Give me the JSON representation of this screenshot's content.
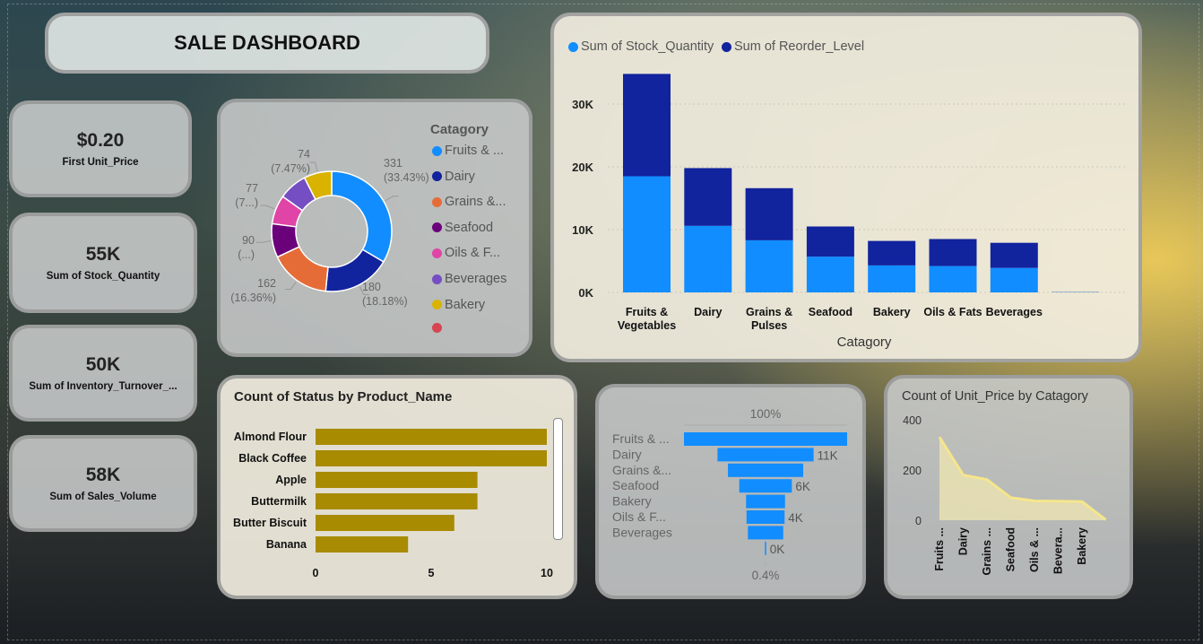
{
  "header": {
    "title": "SALE DASHBOARD"
  },
  "kpis": [
    {
      "value": "$0.20",
      "label": "First Unit_Price"
    },
    {
      "value": "55K",
      "label": "Sum of Stock_Quantity"
    },
    {
      "value": "50K",
      "label": "Sum of Inventory_Turnover_..."
    },
    {
      "value": "58K",
      "label": "Sum of Sales_Volume"
    }
  ],
  "colors": {
    "stock": "#118DFF",
    "reorder": "#12239E",
    "hbar": "#A88B00",
    "funnel": "#118DFF",
    "area_line": "#F5E68C",
    "area_fill": "#F3E9B0"
  },
  "chart_data": [
    {
      "id": "donut",
      "type": "pie",
      "legend_title": "Catagory",
      "legend": [
        "Fruits & ...",
        "Dairy",
        "Grains &...",
        "Seafood",
        "Oils & F...",
        "Beverages",
        "Bakery",
        ""
      ],
      "slices": [
        {
          "value": 331,
          "label": "331",
          "pct": "(33.43%)",
          "color": "#118DFF"
        },
        {
          "value": 180,
          "label": "180",
          "pct": "(18.18%)",
          "color": "#12239E"
        },
        {
          "value": 162,
          "label": "162",
          "pct": "(16.36%)",
          "color": "#E66C37"
        },
        {
          "value": 90,
          "label": "90",
          "pct": "(...)",
          "color": "#6B007B"
        },
        {
          "value": 77,
          "label": "77",
          "pct": "(7...)",
          "color": "#E044A7"
        },
        {
          "value": 76,
          "label": "",
          "pct": "",
          "color": "#744EC2"
        },
        {
          "value": 74,
          "label": "74",
          "pct": "(7.47%)",
          "color": "#D9B300"
        }
      ],
      "legend_colors": [
        "#118DFF",
        "#12239E",
        "#E66C37",
        "#6B007B",
        "#E044A7",
        "#744EC2",
        "#D9B300",
        "#D64550"
      ]
    },
    {
      "id": "stacked",
      "type": "bar",
      "legend": [
        "Sum of Stock_Quantity",
        "Sum of Reorder_Level"
      ],
      "categories": [
        "Fruits & Vegetables",
        "Dairy",
        "Grains & Pulses",
        "Seafood",
        "Bakery",
        "Oils & Fats",
        "Beverages",
        ""
      ],
      "category_lines": [
        [
          "Fruits &",
          "Vegetables"
        ],
        [
          "Dairy"
        ],
        [
          "Grains &",
          "Pulses"
        ],
        [
          "Seafood"
        ],
        [
          "Bakery"
        ],
        [
          "Oils & Fats"
        ],
        [
          "Beverages"
        ],
        [
          ""
        ]
      ],
      "series": [
        {
          "name": "Sum of Stock_Quantity",
          "values": [
            18500,
            10600,
            8300,
            5700,
            4300,
            4200,
            3900,
            80
          ]
        },
        {
          "name": "Sum of Reorder_Level",
          "values": [
            16300,
            9200,
            8300,
            4800,
            3900,
            4300,
            4000,
            40
          ]
        }
      ],
      "xlabel": "Catagory",
      "yticks": [
        "0K",
        "10K",
        "20K",
        "30K"
      ],
      "ylim": [
        0,
        36000
      ]
    },
    {
      "id": "hbar",
      "type": "bar",
      "orientation": "horizontal",
      "title": "Count of Status by Product_Name",
      "categories": [
        "Almond Flour",
        "Black Coffee",
        "Apple",
        "Buttermilk",
        "Butter Biscuit",
        "Banana"
      ],
      "values": [
        10,
        10,
        7,
        7,
        6,
        4
      ],
      "xticks": [
        "0",
        "5",
        "10"
      ],
      "xlim": [
        0,
        10
      ]
    },
    {
      "id": "funnel",
      "type": "bar",
      "subtype": "funnel",
      "top_label": "100%",
      "bottom_label": "0.4%",
      "categories": [
        "Fruits & ...",
        "Dairy",
        "Grains &...",
        "Seafood",
        "Bakery",
        "Oils & F...",
        "Beverages"
      ],
      "values": [
        18000,
        10600,
        8300,
        5800,
        4300,
        4200,
        3900,
        80
      ],
      "value_labels": [
        "",
        "11K",
        "",
        "6K",
        "",
        "4K",
        "",
        "0K"
      ]
    },
    {
      "id": "area",
      "type": "area",
      "title": "Count of Unit_Price by Catagory",
      "categories": [
        "Fruits ...",
        "Dairy",
        "Grains ...",
        "Seafood",
        "Oils & ...",
        "Bevera...",
        "Bakery",
        ""
      ],
      "values": [
        331,
        180,
        162,
        90,
        77,
        76,
        74,
        2
      ],
      "yticks": [
        "0",
        "200",
        "400"
      ],
      "ylim": [
        0,
        400
      ]
    }
  ]
}
